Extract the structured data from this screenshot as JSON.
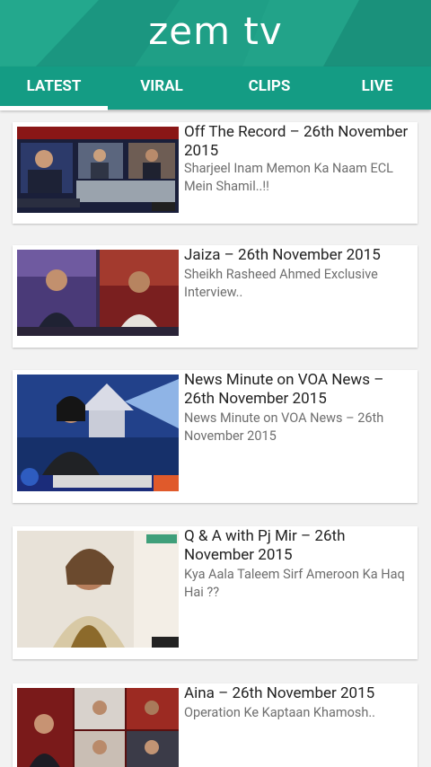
{
  "app": {
    "logo": "zem tv",
    "header_color": "#1f9f86",
    "accent_color": "#149c84"
  },
  "tabs": [
    {
      "label": "LATEST",
      "active": true
    },
    {
      "label": "VIRAL",
      "active": false
    },
    {
      "label": "CLIPS",
      "active": false
    },
    {
      "label": "LIVE",
      "active": false
    }
  ],
  "posts": [
    {
      "title": "Off The Record – 26th November 2015",
      "description": "Sharjeel Inam Memon Ka Naam ECL Mein Shamil..!!",
      "thumbnail": "talk-show-panel-thumbnail"
    },
    {
      "title": "Jaiza – 26th November 2015",
      "description": "Sheikh Rasheed Ahmed Exclusive Interview..",
      "thumbnail": "interview-split-screen-thumbnail"
    },
    {
      "title": "News Minute on VOA News – 26th November 2015",
      "description": "News Minute on VOA News – 26th November 2015",
      "thumbnail": "news-anchor-thumbnail"
    },
    {
      "title": "Q & A with Pj Mir – 26th November 2015",
      "description": "Kya Aala Taleem Sirf Ameroon Ka Haq Hai ??",
      "thumbnail": "guest-closeup-thumbnail"
    },
    {
      "title": "Aina – 26th November 2015",
      "description": "Operation Ke Kaptaan Khamosh..",
      "thumbnail": "debate-panel-thumbnail"
    }
  ]
}
